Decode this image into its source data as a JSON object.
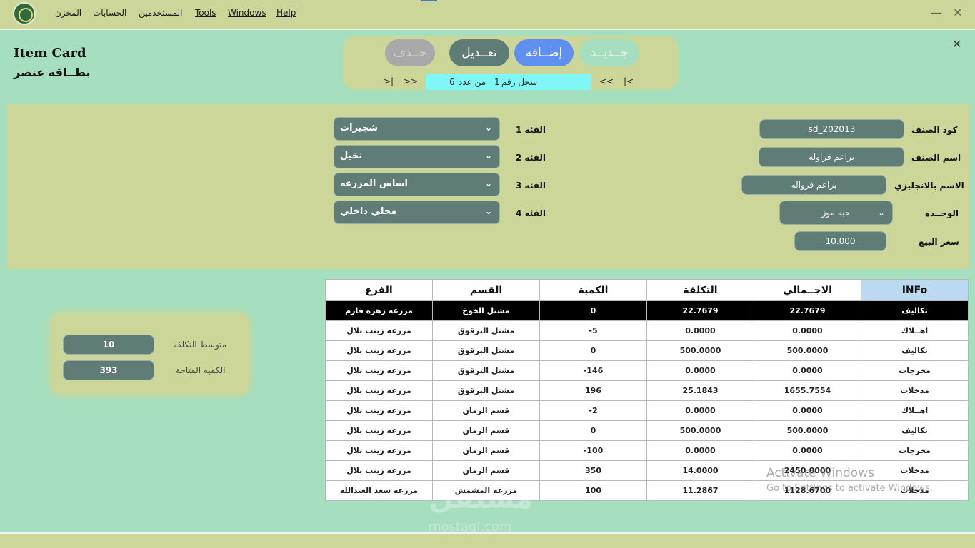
{
  "menu": {
    "items": [
      "المخزن",
      "الحسابات",
      "المستخدمين",
      "Tools",
      "Windows",
      "Help"
    ]
  },
  "window_controls": {
    "minimize": "—",
    "close": "✕"
  },
  "header": {
    "title_en": "Item Card",
    "title_ar": "بطــاقة عنصر"
  },
  "toolbar": {
    "delete_label": "حــذف",
    "edit_label": "تعــديل",
    "add_label": "إضــافه",
    "new_label": "جــديــد"
  },
  "navigator": {
    "last": ">|",
    "next": ">>",
    "prev": "<<",
    "first": "|<",
    "record_label": "سجل رقم",
    "record_number": "1",
    "of_label": "من عدد",
    "record_count": "6"
  },
  "form": {
    "category1_label": "الفئه 1",
    "category1_value": "شجيرات",
    "category2_label": "الفئه 2",
    "category2_value": "نخيل",
    "category3_label": "الفئه 3",
    "category3_value": "اساس المزرعه",
    "category4_label": "الفئه 4",
    "category4_value": "محلي داخلي",
    "code_label": "كود الصنف",
    "code_value": "sd_202013",
    "name_label": "اسم الصنف",
    "name_value": "براعم فراوله",
    "name_en_label": "الاسم بالانجليزي",
    "name_en_value": "براعم فرواله",
    "unit_label": "الوحــده",
    "unit_value": "حبه موز",
    "price_label": "سعر البيع",
    "price_value": "10.000"
  },
  "summary": {
    "avg_cost_label": "متوسط التكلفه",
    "avg_cost_value": "10",
    "available_qty_label": "الكميه المتاحة",
    "available_qty_value": "393"
  },
  "table": {
    "headers": [
      "الفرع",
      "القسم",
      "الكمية",
      "التكلفة",
      "الاجــمالي",
      "INFo"
    ],
    "rows": [
      [
        "مزرعه زهره فارم",
        "مشتل الخوخ",
        "0",
        "22.7679",
        "22.7679",
        "تكاليف"
      ],
      [
        "مزرعه زينب بلال",
        "مشتل البرقوق",
        "-5",
        "0.0000",
        "0.0000",
        "اهــلاك"
      ],
      [
        "مزرعه زينب بلال",
        "مشتل البرقوق",
        "0",
        "500.0000",
        "500.0000",
        "تكاليف"
      ],
      [
        "مزرعه زينب بلال",
        "مشتل البرقوق",
        "-146",
        "0.0000",
        "0.0000",
        "مخرجات"
      ],
      [
        "مزرعه زينب بلال",
        "مشتل البرقوق",
        "196",
        "25.1843",
        "1655.7554",
        "مدخلات"
      ],
      [
        "مزرعه زينب بلال",
        "قسم الرمان",
        "-2",
        "0.0000",
        "0.0000",
        "اهــلاك"
      ],
      [
        "مزرعه زينب بلال",
        "قسم الرمان",
        "0",
        "500.0000",
        "500.0000",
        "تكاليف"
      ],
      [
        "مزرعه زينب بلال",
        "قسم الرمان",
        "-100",
        "0.0000",
        "0.0000",
        "مخرجات"
      ],
      [
        "مزرعه زينب بلال",
        "قسم الرمان",
        "350",
        "14.0000",
        "2450.0000",
        "مدخلات"
      ],
      [
        "مزرعه سعد العبدالله",
        "مزرعه المشمش",
        "100",
        "11.2867",
        "1128.6700",
        "مدخلات"
      ]
    ]
  },
  "watermarks": {
    "activate_title": "Activate Windows",
    "activate_sub": "Go to Settings to activate Windows.",
    "site_ar": "مستقل",
    "site_en": "mostaql.com"
  },
  "colors": {
    "background": "#a6dfbf",
    "panel": "#cdd699",
    "field": "#5f7d76",
    "add_button": "#5f8ff0",
    "edit_button": "#5f7d76",
    "new_button": "#a6dfbf",
    "delete_button": "#a9a9a9",
    "record_bar": "#7ff7f7",
    "info_header": "#bbdaf2"
  },
  "icons": [
    "app-logo-icon",
    "minimize-icon",
    "close-icon",
    "chevron-down-icon"
  ]
}
